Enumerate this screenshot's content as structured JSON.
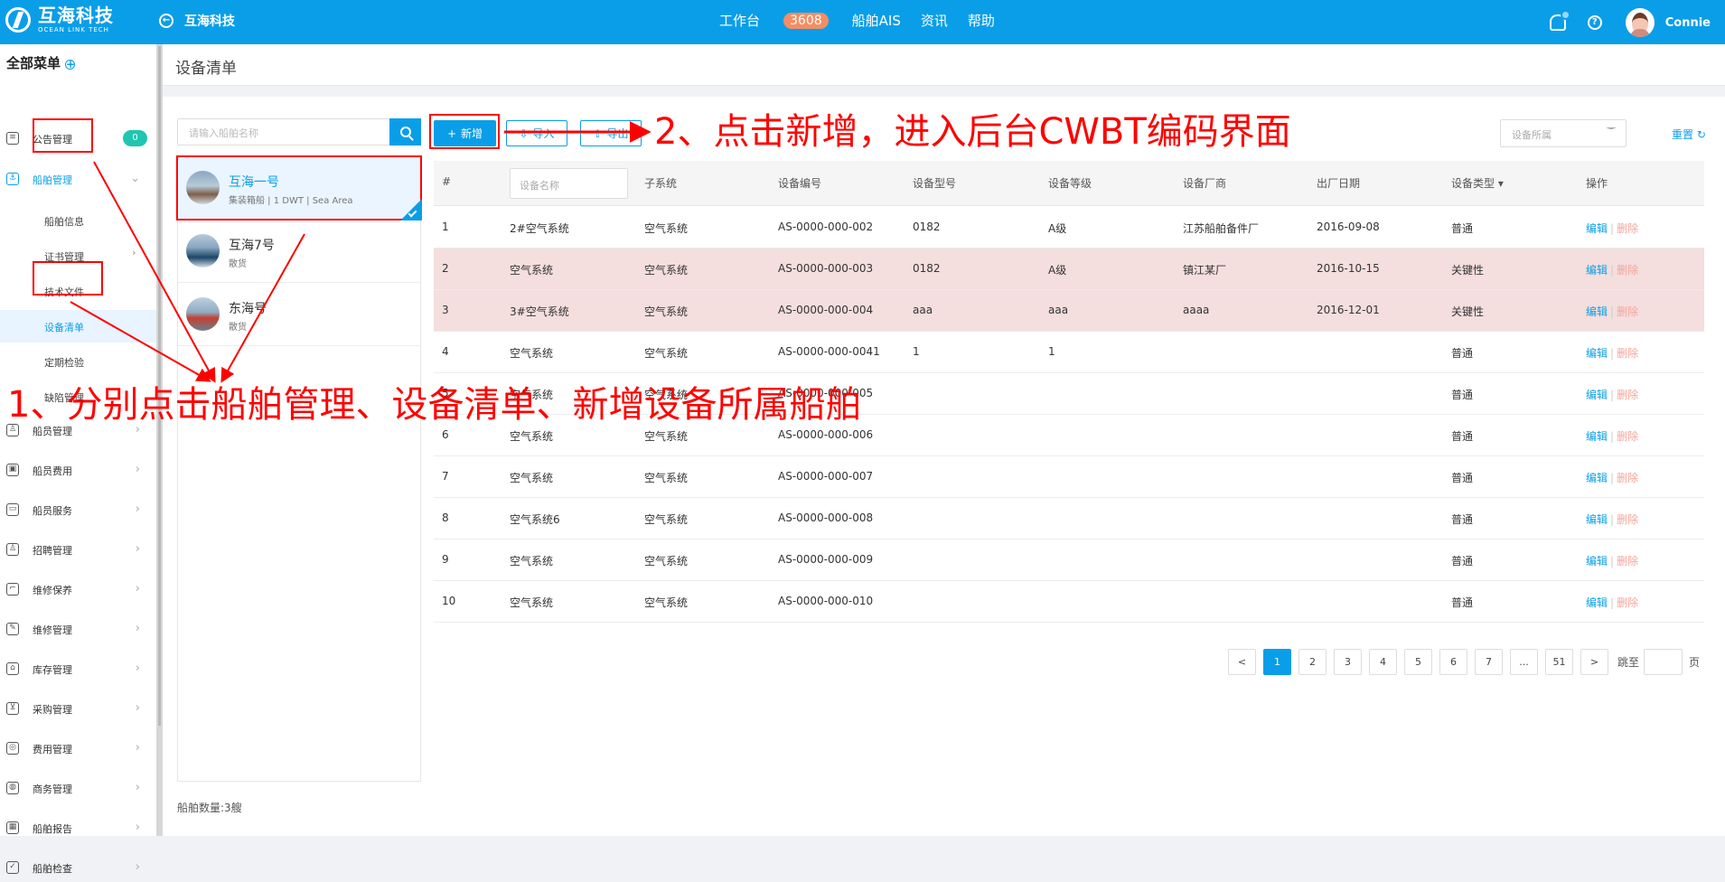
{
  "topbar": {
    "logo_cn": "互海科技",
    "logo_en": "OCEAN LINK TECH",
    "current_company": "互海科技",
    "nav": [
      {
        "label": "工作台",
        "count": "3608"
      },
      {
        "label": "船舶AIS"
      },
      {
        "label": "资讯"
      },
      {
        "label": "帮助"
      }
    ],
    "user": "Connie"
  },
  "sidebar": {
    "title": "全部菜单",
    "items": [
      {
        "label": "公告管理",
        "count": "0"
      },
      {
        "label": "船舶管理"
      },
      {
        "label": "船员管理"
      },
      {
        "label": "船员费用"
      },
      {
        "label": "船员服务"
      },
      {
        "label": "招聘管理"
      },
      {
        "label": "维修保养"
      },
      {
        "label": "维修管理"
      },
      {
        "label": "库存管理"
      },
      {
        "label": "采购管理"
      },
      {
        "label": "费用管理"
      },
      {
        "label": "商务管理"
      },
      {
        "label": "船舶报告"
      },
      {
        "label": "船舶检查"
      }
    ],
    "submenu": [
      {
        "label": "船舶信息"
      },
      {
        "label": "证书管理"
      },
      {
        "label": "技术文件"
      },
      {
        "label": "设备清单"
      },
      {
        "label": "定期检验"
      },
      {
        "label": "缺陷管理"
      }
    ]
  },
  "page": {
    "title": "设备清单",
    "ship_search_placeholder": "请输入船舶名称",
    "ship_count_label": "船舶数量:",
    "ship_count": "3艘",
    "ships": [
      {
        "name": "互海一号",
        "desc": "集装箱船 | 1 DWT | Sea Area"
      },
      {
        "name": "互海7号",
        "desc": "散货"
      },
      {
        "name": "东海号",
        "desc": "散货"
      }
    ],
    "toolbar": {
      "add": "新增",
      "import": "导入",
      "export": "导出",
      "filter_placeholder": "设备所属",
      "reset": "重置"
    }
  },
  "table": {
    "headers": [
      "#",
      "设备名称",
      "子系统",
      "设备编号",
      "设备型号",
      "设备等级",
      "设备厂商",
      "出厂日期",
      "设备类型",
      "操作"
    ],
    "rows": [
      {
        "no": "1",
        "name": "2#空气系统",
        "subsystem": "空气系统",
        "code": "AS-0000-000-002",
        "model": "0182",
        "level": "A级",
        "maker": "江苏船舶备件厂",
        "date": "2016-09-08",
        "type": "普通",
        "edit": "编辑",
        "delete": "删除"
      },
      {
        "no": "2",
        "name": "空气系统",
        "subsystem": "空气系统",
        "code": "AS-0000-000-003",
        "model": "0182",
        "level": "A级",
        "maker": "镇江某厂",
        "date": "2016-10-15",
        "type": "关键性",
        "edit": "编辑",
        "delete": "删除"
      },
      {
        "no": "3",
        "name": "3#空气系统",
        "subsystem": "空气系统",
        "code": "AS-0000-000-004",
        "model": "aaa",
        "level": "aaa",
        "maker": "aaaa",
        "date": "2016-12-01",
        "type": "关键性",
        "edit": "编辑",
        "delete": "删除"
      },
      {
        "no": "4",
        "name": "空气系统",
        "subsystem": "空气系统",
        "code": "AS-0000-000-0041",
        "model": "1",
        "level": "1",
        "maker": "",
        "date": "",
        "type": "普通",
        "edit": "编辑",
        "delete": "删除"
      },
      {
        "no": "5",
        "name": "空气系统",
        "subsystem": "空气系统",
        "code": "AS-0000-000-005",
        "model": "",
        "level": "",
        "maker": "",
        "date": "",
        "type": "普通",
        "edit": "编辑",
        "delete": "删除"
      },
      {
        "no": "6",
        "name": "空气系统",
        "subsystem": "空气系统",
        "code": "AS-0000-000-006",
        "model": "",
        "level": "",
        "maker": "",
        "date": "",
        "type": "普通",
        "edit": "编辑",
        "delete": "删除"
      },
      {
        "no": "7",
        "name": "空气系统",
        "subsystem": "空气系统",
        "code": "AS-0000-000-007",
        "model": "",
        "level": "",
        "maker": "",
        "date": "",
        "type": "普通",
        "edit": "编辑",
        "delete": "删除"
      },
      {
        "no": "8",
        "name": "空气系统6",
        "subsystem": "空气系统",
        "code": "AS-0000-000-008",
        "model": "",
        "level": "",
        "maker": "",
        "date": "",
        "type": "普通",
        "edit": "编辑",
        "delete": "删除"
      },
      {
        "no": "9",
        "name": "空气系统",
        "subsystem": "空气系统",
        "code": "AS-0000-000-009",
        "model": "",
        "level": "",
        "maker": "",
        "date": "",
        "type": "普通",
        "edit": "编辑",
        "delete": "删除"
      },
      {
        "no": "10",
        "name": "空气系统",
        "subsystem": "空气系统",
        "code": "AS-0000-000-010",
        "model": "",
        "level": "",
        "maker": "",
        "date": "",
        "type": "普通",
        "edit": "编辑",
        "delete": "删除"
      }
    ],
    "name_filter_placeholder": "设备名称"
  },
  "pagination": {
    "prev": "<",
    "pages": [
      "1",
      "2",
      "3",
      "4",
      "5",
      "6",
      "7",
      "...",
      "51"
    ],
    "next": ">",
    "jump_label": "跳至",
    "page_unit": "页"
  },
  "annotations": {
    "step1": "1、分别点击船舶管理、设备清单、新增设备所属船舶",
    "step2": "2、点击新增，进入后台CWBT编码界面"
  },
  "colors": {
    "primary": "#0a9ee8",
    "warning_row": "#f4dede",
    "annotation": "#ff0000"
  }
}
